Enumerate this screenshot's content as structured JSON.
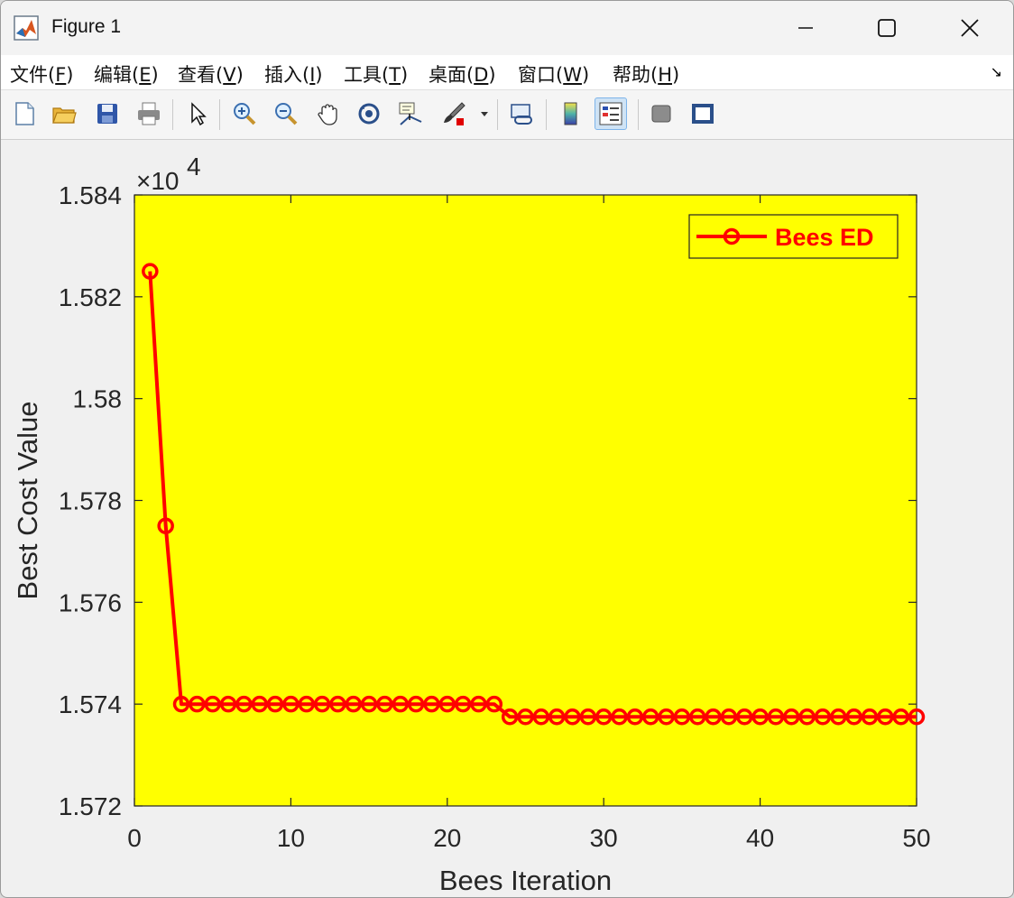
{
  "window": {
    "title": "Figure 1",
    "minimize_glyph": "—",
    "close_glyph": "✕"
  },
  "menu": {
    "items": [
      {
        "label": "文件(",
        "mn": "F",
        "end": ")"
      },
      {
        "label": "编辑(",
        "mn": "E",
        "end": ")"
      },
      {
        "label": "查看(",
        "mn": "V",
        "end": ")"
      },
      {
        "label": "插入(",
        "mn": "I",
        "end": ")"
      },
      {
        "label": "工具(",
        "mn": "T",
        "end": ")"
      },
      {
        "label": "桌面(",
        "mn": "D",
        "end": ")"
      },
      {
        "label": "窗口(",
        "mn": "W",
        "end": ")"
      },
      {
        "label": "帮助(",
        "mn": "H",
        "end": ")"
      }
    ],
    "overflow_glyph": "↘"
  },
  "toolbar": {
    "icons": [
      "new-figure-icon",
      "open-file-icon",
      "save-icon",
      "print-icon",
      "pointer-icon",
      "zoom-in-icon",
      "zoom-out-icon",
      "pan-icon",
      "rotate-3d-icon",
      "data-cursor-icon",
      "brush-icon",
      "link-plot-icon",
      "colorbar-icon",
      "legend-icon",
      "hide-plot-tools-icon",
      "show-plot-tools-icon"
    ],
    "active": "legend-icon"
  },
  "colors": {
    "axes_bg": "#ffff00",
    "series": "#ff0000"
  },
  "chart_data": {
    "type": "line",
    "title": "",
    "xlabel": "Bees Iteration",
    "ylabel": "Best Cost Value",
    "exponent_label": "×10",
    "exponent_power": "4",
    "xlim": [
      0,
      50
    ],
    "ylim": [
      15720,
      15840
    ],
    "xticks": [
      0,
      10,
      20,
      30,
      40,
      50
    ],
    "xtick_labels": [
      "0",
      "10",
      "20",
      "30",
      "40",
      "50"
    ],
    "yticks": [
      15720,
      15740,
      15760,
      15780,
      15800,
      15820,
      15840
    ],
    "ytick_labels": [
      "1.572",
      "1.574",
      "1.576",
      "1.578",
      "1.58",
      "1.582",
      "1.584"
    ],
    "grid": false,
    "legend_location": "top-right",
    "series": [
      {
        "name": "Bees ED",
        "color": "#ff0000",
        "marker": "circle",
        "x": [
          1,
          2,
          3,
          4,
          5,
          6,
          7,
          8,
          9,
          10,
          11,
          12,
          13,
          14,
          15,
          16,
          17,
          18,
          19,
          20,
          21,
          22,
          23,
          24,
          25,
          26,
          27,
          28,
          29,
          30,
          31,
          32,
          33,
          34,
          35,
          36,
          37,
          38,
          39,
          40,
          41,
          42,
          43,
          44,
          45,
          46,
          47,
          48,
          49,
          50
        ],
        "y": [
          15825,
          15775,
          15740,
          15740,
          15740,
          15740,
          15740,
          15740,
          15740,
          15740,
          15740,
          15740,
          15740,
          15740,
          15740,
          15740,
          15740,
          15740,
          15740,
          15740,
          15740,
          15740,
          15740,
          15737.5,
          15737.5,
          15737.5,
          15737.5,
          15737.5,
          15737.5,
          15737.5,
          15737.5,
          15737.5,
          15737.5,
          15737.5,
          15737.5,
          15737.5,
          15737.5,
          15737.5,
          15737.5,
          15737.5,
          15737.5,
          15737.5,
          15737.5,
          15737.5,
          15737.5,
          15737.5,
          15737.5,
          15737.5,
          15737.5,
          15737.5
        ]
      }
    ]
  }
}
